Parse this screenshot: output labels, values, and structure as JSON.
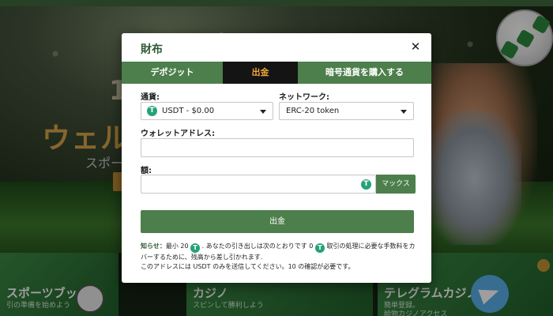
{
  "background": {
    "hero_number": "1",
    "hero_title": "ウェルカ",
    "hero_subtitle": "スポーツ",
    "cards": [
      {
        "title": "スポーツブック",
        "desc": "引の準備を始めよう"
      },
      {
        "title": "カジノ",
        "desc": "スピンして勝利しよう"
      },
      {
        "title": "テレグラムカジノ",
        "desc": "簡単登録。\n絵物カジノアクセス"
      }
    ]
  },
  "modal": {
    "title": "財布",
    "close_glyph": "✕",
    "tabs": [
      {
        "label": "デポジット",
        "active": false
      },
      {
        "label": "出金",
        "active": true
      },
      {
        "label": "暗号通貨を購入する",
        "active": false
      }
    ],
    "currency": {
      "label": "通貨:",
      "value": "USDT - $0.00",
      "icon": "tether-icon"
    },
    "network": {
      "label": "ネットワーク:",
      "value": "ERC-20 token"
    },
    "wallet": {
      "label": "ウォレットアドレス:",
      "value": ""
    },
    "amount": {
      "label": "額:",
      "value": "",
      "icon": "tether-icon"
    },
    "max_label": "マックス",
    "submit_label": "出金",
    "notice": {
      "lead": "知らせ：",
      "part1": "最小 20",
      "part2": ". あなたの引き出しは次のとおりです 0",
      "part3": "取引の処理に必要な手数料をカバーするために、残高から差し引かれます.",
      "line2": "このアドレスには USDT のみを送信してください。10 の確認が必要です。"
    }
  },
  "colors": {
    "brand_green": "#4c7f4b",
    "active_tab_bg": "#141414",
    "active_tab_text": "#f0a43a",
    "tether": "#26a17b"
  }
}
